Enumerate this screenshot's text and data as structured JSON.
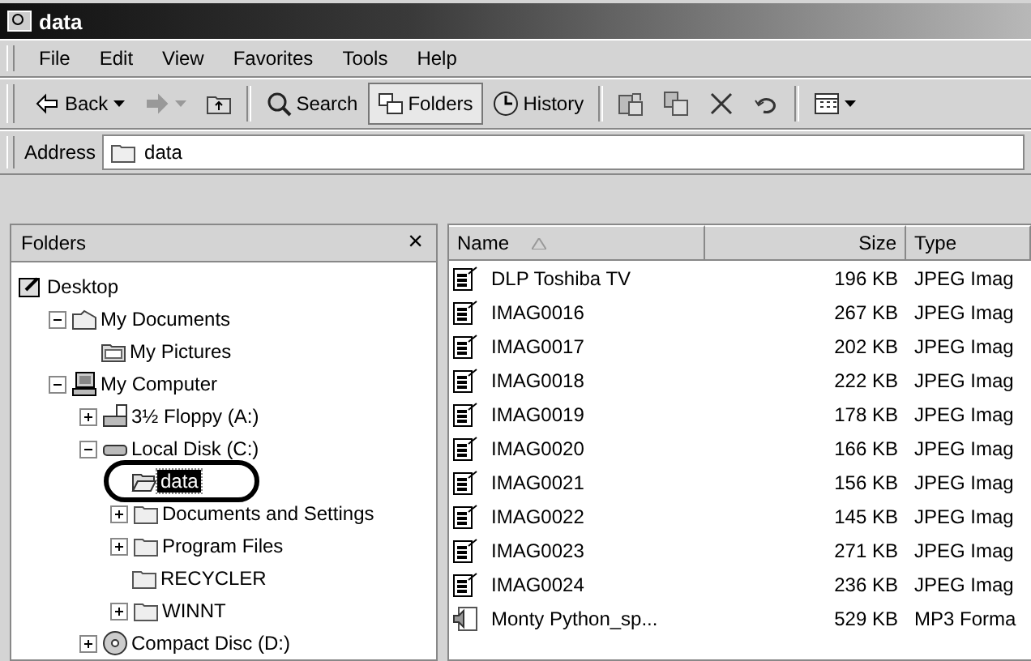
{
  "window": {
    "title": "data"
  },
  "menu": [
    "File",
    "Edit",
    "View",
    "Favorites",
    "Tools",
    "Help"
  ],
  "toolbar": [
    {
      "kind": "back",
      "label": "Back",
      "dropdown": true,
      "pressed": false,
      "disabled": false
    },
    {
      "kind": "forward",
      "dropdown": true,
      "pressed": false,
      "disabled": true
    },
    {
      "kind": "up",
      "pressed": false
    },
    {
      "kind": "separator"
    },
    {
      "kind": "search",
      "label": "Search",
      "pressed": false,
      "disabled": false
    },
    {
      "kind": "folders",
      "label": "Folders",
      "pressed": true,
      "disabled": false
    },
    {
      "kind": "history",
      "label": "History",
      "pressed": false,
      "disabled": false
    },
    {
      "kind": "separator"
    },
    {
      "kind": "move",
      "pressed": false
    },
    {
      "kind": "copy",
      "pressed": false
    },
    {
      "kind": "delete",
      "pressed": false
    },
    {
      "kind": "undo",
      "pressed": false
    },
    {
      "kind": "separator"
    },
    {
      "kind": "views",
      "dropdown": true,
      "pressed": false,
      "disabled": false
    }
  ],
  "address": {
    "label": "Address",
    "value": "data"
  },
  "folders_pane": {
    "title": "Folders",
    "close": "×",
    "tree": [
      {
        "label": "Desktop",
        "kind": "desktop",
        "selected": false,
        "children": [
          {
            "label": "My Documents",
            "kind": "documents",
            "expanded": true,
            "selected": false,
            "children": [
              {
                "label": "My Pictures",
                "kind": "pictures",
                "selected": false
              }
            ]
          },
          {
            "label": "My Computer",
            "kind": "computer",
            "expanded": true,
            "selected": false,
            "children": [
              {
                "label": "3½ Floppy (A:)",
                "kind": "floppy",
                "expanded": false,
                "selected": false
              },
              {
                "label": "Local Disk (C:)",
                "kind": "disk",
                "expanded": true,
                "selected": false,
                "children": [
                  {
                    "label": "data",
                    "kind": "openfolder",
                    "selected": true
                  },
                  {
                    "label": "Documents and Settings",
                    "kind": "folder",
                    "expanded": false,
                    "selected": false
                  },
                  {
                    "label": "Program Files",
                    "kind": "folder",
                    "expanded": false,
                    "selected": false
                  },
                  {
                    "label": "RECYCLER",
                    "kind": "folder",
                    "selected": false
                  },
                  {
                    "label": "WINNT",
                    "kind": "folder",
                    "expanded": false,
                    "selected": false
                  }
                ]
              },
              {
                "label": "Compact Disc (D:)",
                "kind": "cd",
                "expanded": false,
                "selected": false
              }
            ]
          }
        ]
      }
    ]
  },
  "file_list": {
    "columns": [
      {
        "label": "Name",
        "sorted": true
      },
      {
        "label": "Size",
        "sorted": false
      },
      {
        "label": "Type",
        "sorted": false
      }
    ],
    "rows": [
      {
        "kind": "image",
        "name": "DLP Toshiba TV",
        "size": "196 KB",
        "type": "JPEG Imag"
      },
      {
        "kind": "image",
        "name": "IMAG0016",
        "size": "267 KB",
        "type": "JPEG Imag"
      },
      {
        "kind": "image",
        "name": "IMAG0017",
        "size": "202 KB",
        "type": "JPEG Imag"
      },
      {
        "kind": "image",
        "name": "IMAG0018",
        "size": "222 KB",
        "type": "JPEG Imag"
      },
      {
        "kind": "image",
        "name": "IMAG0019",
        "size": "178 KB",
        "type": "JPEG Imag"
      },
      {
        "kind": "image",
        "name": "IMAG0020",
        "size": "166 KB",
        "type": "JPEG Imag"
      },
      {
        "kind": "image",
        "name": "IMAG0021",
        "size": "156 KB",
        "type": "JPEG Imag"
      },
      {
        "kind": "image",
        "name": "IMAG0022",
        "size": "145 KB",
        "type": "JPEG Imag"
      },
      {
        "kind": "image",
        "name": "IMAG0023",
        "size": "271 KB",
        "type": "JPEG Imag"
      },
      {
        "kind": "image",
        "name": "IMAG0024",
        "size": "236 KB",
        "type": "JPEG Imag"
      },
      {
        "kind": "audio",
        "name": "Monty Python_sp...",
        "size": "529 KB",
        "type": "MP3 Forma"
      }
    ]
  }
}
